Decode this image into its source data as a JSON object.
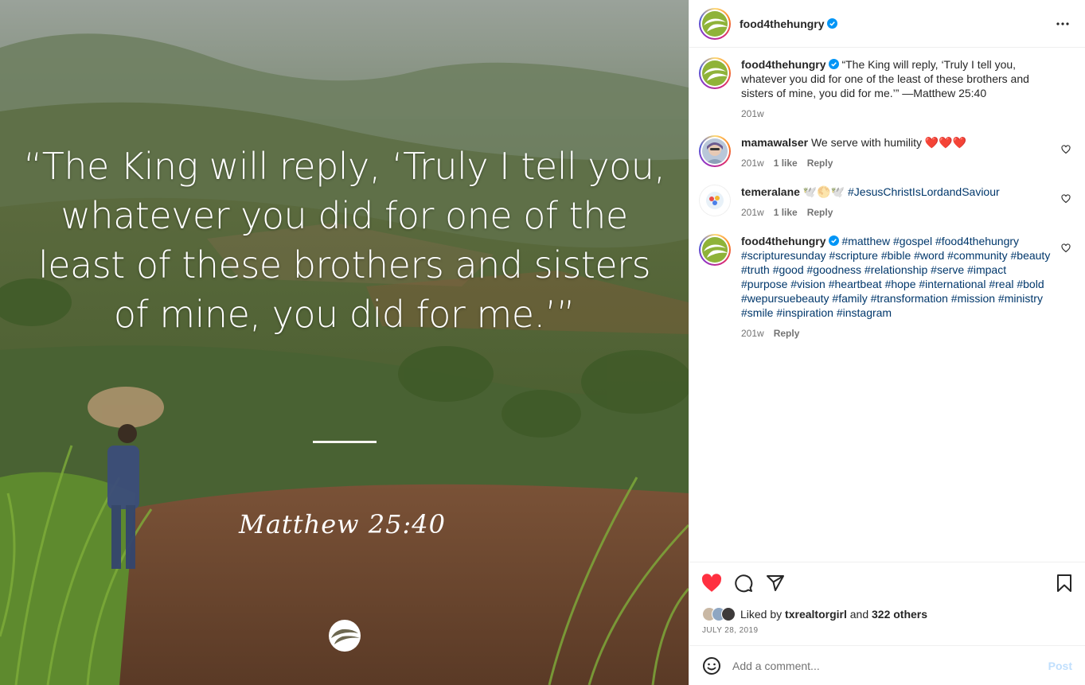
{
  "post_image": {
    "quote": "“The King will reply, ‘Truly I tell you, whatever you did for one of the least of these brothers and sisters of mine, you did for me.’”",
    "reference": "Matthew 25:40"
  },
  "header": {
    "username": "food4thehungry",
    "more_icon": "more-horizontal-icon"
  },
  "caption": {
    "username": "food4thehungry",
    "text": "“The King will reply, ‘Truly I tell you, whatever you did for one of the least of these brothers and sisters of mine, you did for me.’” —Matthew 25:40",
    "age": "201w"
  },
  "comments": [
    {
      "username": "mamawalser",
      "text": "We serve with humility ❤️❤️❤️",
      "age": "201w",
      "likes": "1 like",
      "reply": "Reply"
    },
    {
      "username": "temeralane",
      "emoji": "🕊️🌕🕊️",
      "hashtag": "#JesusChristIsLordandSaviour",
      "age": "201w",
      "likes": "1 like",
      "reply": "Reply"
    },
    {
      "username": "food4thehungry",
      "hashtags": "#matthew #gospel #food4thehungry #scripturesunday #scripture #bible #word #community #beauty #truth #good #goodness #relationship #serve #impact #purpose #vision #heartbeat #hope #international #real #bold #wepursuebeauty #family #transformation #mission #ministry #smile #inspiration #instagram",
      "age": "201w",
      "reply": "Reply"
    }
  ],
  "likes": {
    "prefix": "Liked by ",
    "user": "txrealtorgirl",
    "middle": " and ",
    "others": "322 others"
  },
  "date": "JULY 28, 2019",
  "composer": {
    "placeholder": "Add a comment...",
    "post_label": "Post"
  },
  "colors": {
    "like_red": "#ff3040",
    "link_blue": "#00376b",
    "verified_blue": "#0095f6",
    "post_disabled": "#c0dffd"
  }
}
